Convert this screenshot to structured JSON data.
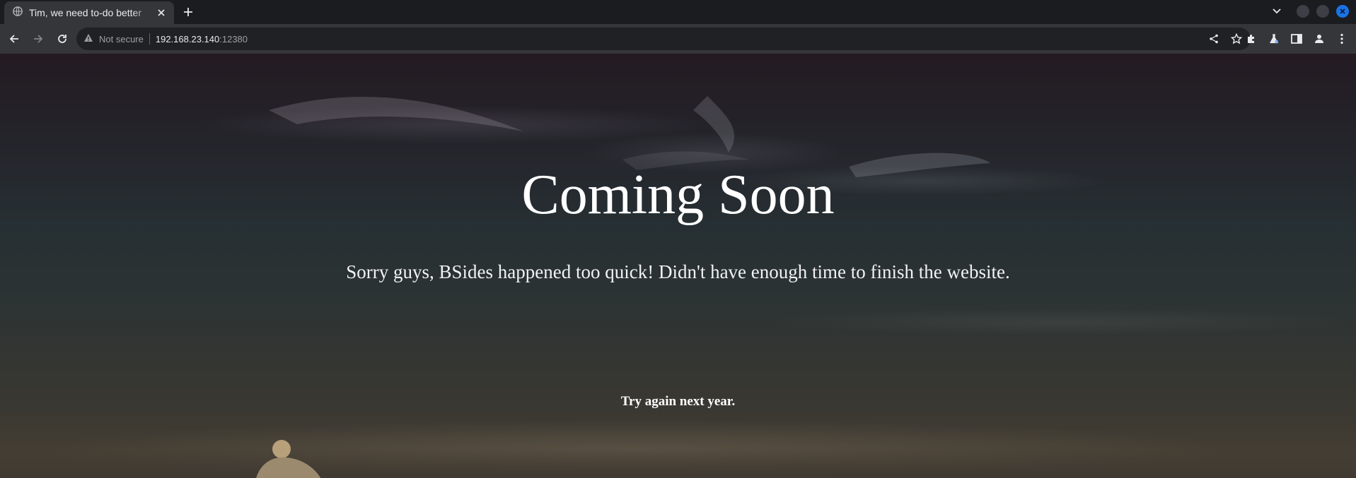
{
  "browser": {
    "tab": {
      "title": "Tim, we need to-do better"
    },
    "address_bar": {
      "security_label": "Not secure",
      "host": "192.168.23.140",
      "port": ":12380"
    },
    "accent_color": "#1a73e8"
  },
  "page": {
    "title": "Coming Soon",
    "subtitle": "Sorry guys, BSides happened too quick! Didn't have enough time to finish the website.",
    "footer": "Try again next year."
  }
}
